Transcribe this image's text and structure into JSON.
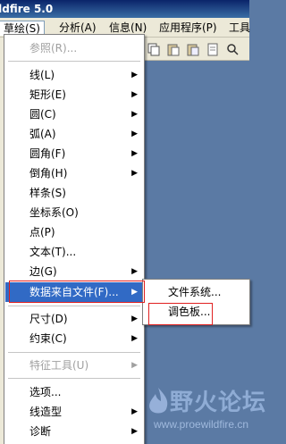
{
  "window": {
    "title": "ildfire 5.0"
  },
  "menubar": [
    {
      "label": "草绘(S)"
    },
    {
      "label": "分析(A)"
    },
    {
      "label": "信息(N)"
    },
    {
      "label": "应用程序(P)"
    },
    {
      "label": "工具"
    }
  ],
  "menu": {
    "items": [
      {
        "label": "参照(R)...",
        "disabled": true,
        "submenu": false
      },
      {
        "label": "线(L)",
        "disabled": false,
        "submenu": true
      },
      {
        "label": "矩形(E)",
        "disabled": false,
        "submenu": true
      },
      {
        "label": "圆(C)",
        "disabled": false,
        "submenu": true
      },
      {
        "label": "弧(A)",
        "disabled": false,
        "submenu": true
      },
      {
        "label": "圆角(F)",
        "disabled": false,
        "submenu": true
      },
      {
        "label": "倒角(H)",
        "disabled": false,
        "submenu": true
      },
      {
        "label": "样条(S)",
        "disabled": false,
        "submenu": false
      },
      {
        "label": "坐标系(O)",
        "disabled": false,
        "submenu": false
      },
      {
        "label": "点(P)",
        "disabled": false,
        "submenu": false
      },
      {
        "label": "文本(T)...",
        "disabled": false,
        "submenu": false
      },
      {
        "label": "边(G)",
        "disabled": false,
        "submenu": true
      },
      {
        "label": "数据来自文件(F)...",
        "disabled": false,
        "submenu": true,
        "highlighted": true
      },
      {
        "label": "尺寸(D)",
        "disabled": false,
        "submenu": true
      },
      {
        "label": "约束(C)",
        "disabled": false,
        "submenu": true
      },
      {
        "label": "特征工具(U)",
        "disabled": true,
        "submenu": true
      },
      {
        "label": "选项...",
        "disabled": false,
        "submenu": false
      },
      {
        "label": "线造型",
        "disabled": false,
        "submenu": true
      },
      {
        "label": "诊断",
        "disabled": false,
        "submenu": true
      }
    ],
    "arrow_glyph": "▶"
  },
  "submenu": {
    "items": [
      {
        "label": "文件系统..."
      },
      {
        "label": "调色板..."
      }
    ]
  },
  "watermark": {
    "title": "野火论坛",
    "url": "www.proewildfire.cn"
  },
  "colors": {
    "highlight": "#316ac5",
    "annotation": "#e02020",
    "menubar": "#ece9d8",
    "workspace": "#5b7aa4"
  }
}
